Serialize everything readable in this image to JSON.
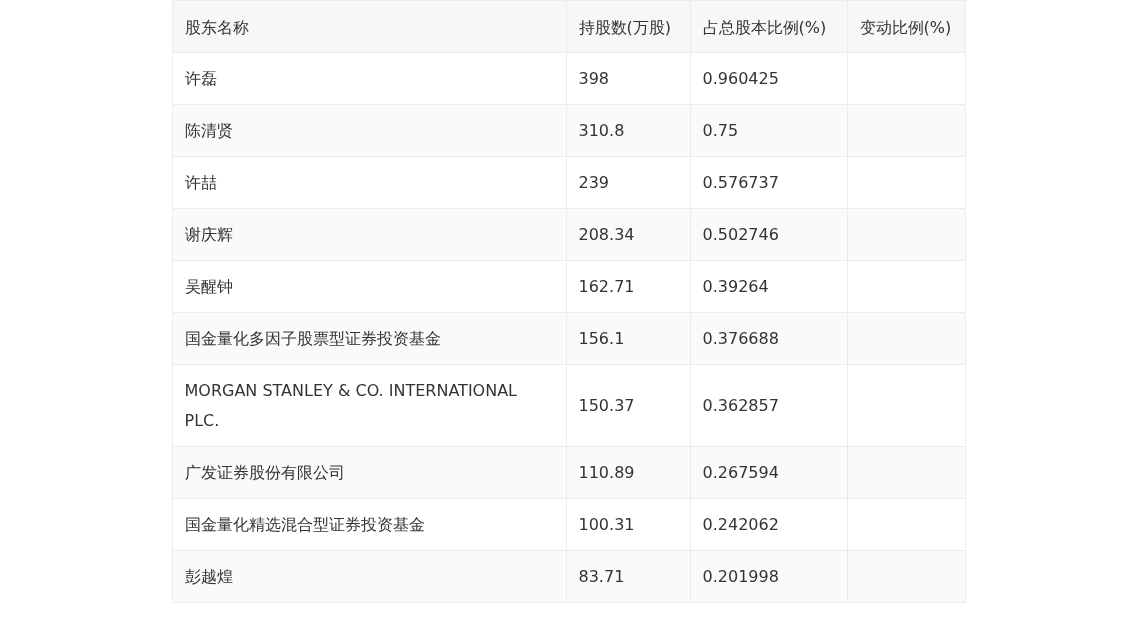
{
  "table": {
    "columns": [
      "股东名称",
      "持股数(万股)",
      "占总股本比例(%)",
      "变动比例(%)"
    ],
    "rows": [
      [
        "许磊",
        "398",
        "0.960425",
        ""
      ],
      [
        "陈清贤",
        "310.8",
        "0.75",
        ""
      ],
      [
        "许喆",
        "239",
        "0.576737",
        ""
      ],
      [
        "谢庆辉",
        "208.34",
        "0.502746",
        ""
      ],
      [
        "吴醒钟",
        "162.71",
        "0.39264",
        ""
      ],
      [
        "国金量化多因子股票型证券投资基金",
        "156.1",
        "0.376688",
        ""
      ],
      [
        "MORGAN STANLEY & CO. INTERNATIONAL PLC.",
        "150.37",
        "0.362857",
        ""
      ],
      [
        "广发证券股份有限公司",
        "110.89",
        "0.267594",
        ""
      ],
      [
        "国金量化精选混合型证券投资基金",
        "100.31",
        "0.242062",
        ""
      ],
      [
        "彭越煌",
        "83.71",
        "0.201998",
        ""
      ]
    ]
  }
}
